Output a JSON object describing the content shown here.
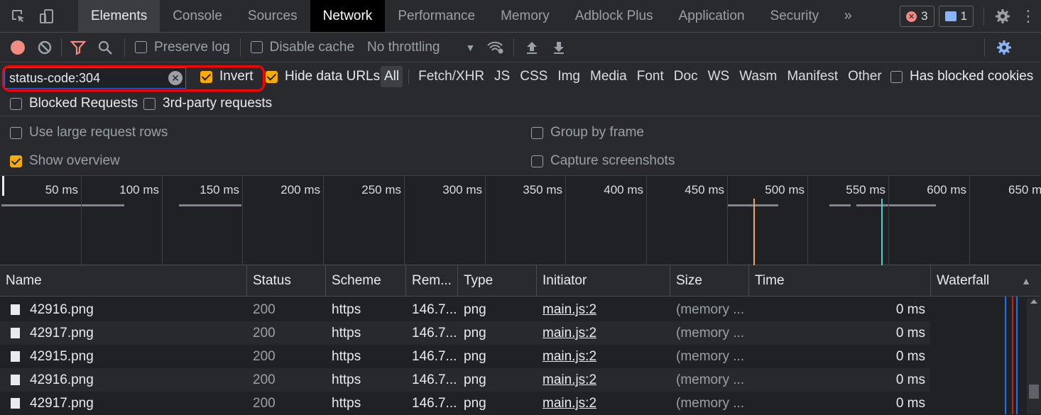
{
  "tabs": [
    "Elements",
    "Console",
    "Sources",
    "Network",
    "Performance",
    "Memory",
    "Adblock Plus",
    "Application",
    "Security"
  ],
  "badges": {
    "errors": "3",
    "messages": "1"
  },
  "toolbar": {
    "preserve_log": "Preserve log",
    "disable_cache": "Disable cache",
    "throttling": "No throttling"
  },
  "filter": {
    "value": "status-code:304",
    "invert": "Invert",
    "hide_data_urls": "Hide data URLs",
    "types": [
      "All",
      "Fetch/XHR",
      "JS",
      "CSS",
      "Img",
      "Media",
      "Font",
      "Doc",
      "WS",
      "Wasm",
      "Manifest",
      "Other"
    ],
    "has_blocked_cookies": "Has blocked cookies",
    "blocked_requests": "Blocked Requests",
    "third_party": "3rd-party requests"
  },
  "settings": {
    "large_rows": "Use large request rows",
    "show_overview": "Show overview",
    "group_by_frame": "Group by frame",
    "capture_screenshots": "Capture screenshots"
  },
  "overview": {
    "ticks": [
      "50 ms",
      "100 ms",
      "150 ms",
      "200 ms",
      "250 ms",
      "300 ms",
      "350 ms",
      "400 ms",
      "450 ms",
      "500 ms",
      "550 ms",
      "600 ms",
      "650 m"
    ]
  },
  "table": {
    "columns": [
      "Name",
      "Status",
      "Scheme",
      "Rem...",
      "Type",
      "Initiator",
      "Size",
      "Time",
      "Waterfall"
    ],
    "rows": [
      {
        "name": "42916.png",
        "status": "200",
        "scheme": "https",
        "remote": "146.7...",
        "type": "png",
        "initiator": "main.js:2",
        "size": "(memory ...",
        "time": "0 ms"
      },
      {
        "name": "42917.png",
        "status": "200",
        "scheme": "https",
        "remote": "146.7...",
        "type": "png",
        "initiator": "main.js:2",
        "size": "(memory ...",
        "time": "0 ms"
      },
      {
        "name": "42915.png",
        "status": "200",
        "scheme": "https",
        "remote": "146.7...",
        "type": "png",
        "initiator": "main.js:2",
        "size": "(memory ...",
        "time": "0 ms"
      },
      {
        "name": "42916.png",
        "status": "200",
        "scheme": "https",
        "remote": "146.7...",
        "type": "png",
        "initiator": "main.js:2",
        "size": "(memory ...",
        "time": "0 ms"
      },
      {
        "name": "42917.png",
        "status": "200",
        "scheme": "https",
        "remote": "146.7...",
        "type": "png",
        "initiator": "main.js:2",
        "size": "(memory ...",
        "time": "0 ms"
      }
    ]
  }
}
